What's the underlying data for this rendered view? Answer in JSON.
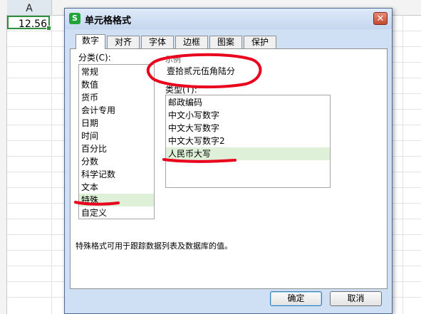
{
  "spreadsheet": {
    "column_header": "A",
    "cell_value": "12.56"
  },
  "dialog": {
    "title": "单元格格式",
    "app_icon": "S",
    "close_glyph": "✕",
    "tabs": [
      {
        "label": "数字"
      },
      {
        "label": "对齐"
      },
      {
        "label": "字体"
      },
      {
        "label": "边框"
      },
      {
        "label": "图案"
      },
      {
        "label": "保护"
      }
    ],
    "category_label": "分类(C):",
    "categories": [
      "常规",
      "数值",
      "货币",
      "会计专用",
      "日期",
      "时间",
      "百分比",
      "分数",
      "科学记数",
      "文本",
      "特殊",
      "自定义"
    ],
    "selected_category": "特殊",
    "sample_label": "示例",
    "sample_value": "壹拾贰元伍角陆分",
    "type_label": "类型(T):",
    "types": [
      "邮政编码",
      "中文小写数字",
      "中文大写数字",
      "中文大写数字2",
      "人民币大写"
    ],
    "selected_type": "人民币大写",
    "description": "特殊格式可用于跟踪数据列表及数据库的值。",
    "ok_label": "确定",
    "cancel_label": "取消"
  },
  "colors": {
    "cell_border": "#2d8f3e",
    "dialog_bg": "#cfe0f4",
    "selection_bg": "#dff0d8",
    "annotation_red": "#e8001c"
  }
}
